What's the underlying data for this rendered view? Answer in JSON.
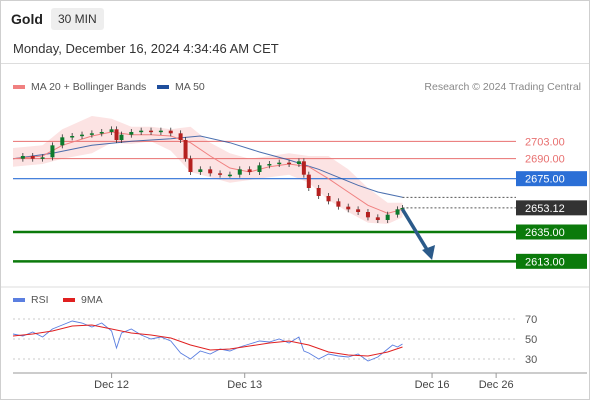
{
  "header": {
    "ticker": "Gold",
    "timeframe": "30 MIN",
    "datetime": "Monday, December 16, 2024 4:34:46 AM CET"
  },
  "legend": {
    "ma20": {
      "label": "MA 20 + Bollinger Bands",
      "color": "#f08080"
    },
    "ma50": {
      "label": "MA 50",
      "color": "#1f4e9c"
    },
    "copyright": "Research © 2024 Trading Central"
  },
  "rsi_legend": {
    "rsi": {
      "label": "RSI",
      "color": "#5b7fe0"
    },
    "ma9": {
      "label": "9MA",
      "color": "#e02020"
    }
  },
  "chart_data": [
    {
      "type": "line",
      "panel": "price",
      "ylim": [
        2602,
        2722
      ],
      "xlim": [
        0,
        100
      ],
      "x_ticks": [
        {
          "label": "Dec 12",
          "x": 20
        },
        {
          "label": "Dec 13",
          "x": 47
        },
        {
          "label": "Dec 16",
          "x": 85
        },
        {
          "label": "Dec 26",
          "x": 98
        }
      ],
      "levels": [
        {
          "label": "2703.00",
          "value": 2703.0,
          "color": "#e87070",
          "width": 1,
          "tag": "plain"
        },
        {
          "label": "2690.00",
          "value": 2690.0,
          "color": "#e87070",
          "width": 1,
          "tag": "plain"
        },
        {
          "label": "2675.00",
          "value": 2675.0,
          "color": "#2b6fd6",
          "width": 1.2,
          "tag": "box"
        },
        {
          "label": "2635.00",
          "value": 2635.0,
          "color": "#0b7a0b",
          "width": 2.5,
          "tag": "box"
        },
        {
          "label": "2613.00",
          "value": 2613.0,
          "color": "#0b7a0b",
          "width": 2.5,
          "tag": "box"
        }
      ],
      "last_price": {
        "label": "2653.12",
        "value": 2653.12,
        "color": "#333333"
      },
      "forecast_arrow": {
        "from": [
          79,
          2652
        ],
        "to": [
          85,
          2614
        ],
        "color": "#2b5a8a"
      },
      "ma20": [
        [
          0,
          2690
        ],
        [
          6,
          2692
        ],
        [
          10,
          2700
        ],
        [
          16,
          2707
        ],
        [
          20,
          2710
        ],
        [
          24,
          2708
        ],
        [
          28,
          2708
        ],
        [
          32,
          2707
        ],
        [
          36,
          2702
        ],
        [
          40,
          2692
        ],
        [
          44,
          2683
        ],
        [
          48,
          2680
        ],
        [
          52,
          2684
        ],
        [
          56,
          2686
        ],
        [
          60,
          2684
        ],
        [
          64,
          2675
        ],
        [
          68,
          2665
        ],
        [
          72,
          2655
        ],
        [
          76,
          2649
        ],
        [
          79,
          2652
        ]
      ],
      "ma50": [
        [
          0,
          2690
        ],
        [
          8,
          2694
        ],
        [
          16,
          2700
        ],
        [
          24,
          2703
        ],
        [
          32,
          2705
        ],
        [
          38,
          2707
        ],
        [
          44,
          2702
        ],
        [
          50,
          2695
        ],
        [
          56,
          2689
        ],
        [
          62,
          2682
        ],
        [
          66,
          2676
        ],
        [
          70,
          2670
        ],
        [
          74,
          2665
        ],
        [
          79,
          2661
        ]
      ],
      "bb_upper": [
        [
          0,
          2698
        ],
        [
          6,
          2700
        ],
        [
          10,
          2712
        ],
        [
          16,
          2722
        ],
        [
          20,
          2720
        ],
        [
          24,
          2714
        ],
        [
          28,
          2714
        ],
        [
          32,
          2712
        ],
        [
          36,
          2714
        ],
        [
          40,
          2702
        ],
        [
          44,
          2694
        ],
        [
          48,
          2690
        ],
        [
          52,
          2692
        ],
        [
          56,
          2694
        ],
        [
          60,
          2692
        ],
        [
          64,
          2692
        ],
        [
          68,
          2682
        ],
        [
          72,
          2668
        ],
        [
          76,
          2657
        ],
        [
          79,
          2657
        ]
      ],
      "bb_lower": [
        [
          0,
          2684
        ],
        [
          6,
          2686
        ],
        [
          10,
          2690
        ],
        [
          16,
          2694
        ],
        [
          20,
          2702
        ],
        [
          24,
          2701
        ],
        [
          28,
          2703
        ],
        [
          32,
          2696
        ],
        [
          36,
          2680
        ],
        [
          40,
          2676
        ],
        [
          44,
          2672
        ],
        [
          48,
          2674
        ],
        [
          52,
          2676
        ],
        [
          56,
          2678
        ],
        [
          60,
          2672
        ],
        [
          64,
          2659
        ],
        [
          68,
          2650
        ],
        [
          72,
          2642
        ],
        [
          76,
          2641
        ],
        [
          79,
          2646
        ]
      ],
      "price": [
        [
          0,
          2690
        ],
        [
          2,
          2692
        ],
        [
          4,
          2690
        ],
        [
          6,
          2691
        ],
        [
          8,
          2700
        ],
        [
          10,
          2706
        ],
        [
          12,
          2707
        ],
        [
          14,
          2708
        ],
        [
          16,
          2709
        ],
        [
          18,
          2710
        ],
        [
          20,
          2712
        ],
        [
          21,
          2704
        ],
        [
          22,
          2708
        ],
        [
          24,
          2710
        ],
        [
          26,
          2711
        ],
        [
          28,
          2710
        ],
        [
          30,
          2711
        ],
        [
          32,
          2709
        ],
        [
          34,
          2704
        ],
        [
          35,
          2690
        ],
        [
          36,
          2680
        ],
        [
          38,
          2682
        ],
        [
          40,
          2679
        ],
        [
          42,
          2678
        ],
        [
          44,
          2678
        ],
        [
          46,
          2682
        ],
        [
          48,
          2680
        ],
        [
          50,
          2685
        ],
        [
          52,
          2686
        ],
        [
          54,
          2687
        ],
        [
          56,
          2686
        ],
        [
          58,
          2688
        ],
        [
          59,
          2678
        ],
        [
          60,
          2668
        ],
        [
          62,
          2662
        ],
        [
          64,
          2658
        ],
        [
          66,
          2654
        ],
        [
          68,
          2652
        ],
        [
          70,
          2650
        ],
        [
          72,
          2646
        ],
        [
          74,
          2644
        ],
        [
          76,
          2648
        ],
        [
          78,
          2652
        ],
        [
          79,
          2653
        ]
      ]
    },
    {
      "type": "line",
      "panel": "rsi",
      "ylim": [
        20,
        80
      ],
      "y_ticks": [
        30,
        50,
        70
      ],
      "rsi": [
        [
          0,
          55
        ],
        [
          2,
          53
        ],
        [
          4,
          57
        ],
        [
          6,
          52
        ],
        [
          8,
          60
        ],
        [
          10,
          64
        ],
        [
          12,
          68
        ],
        [
          14,
          66
        ],
        [
          16,
          62
        ],
        [
          18,
          66
        ],
        [
          20,
          58
        ],
        [
          21,
          41
        ],
        [
          22,
          56
        ],
        [
          24,
          60
        ],
        [
          26,
          54
        ],
        [
          28,
          50
        ],
        [
          30,
          52
        ],
        [
          32,
          48
        ],
        [
          34,
          36
        ],
        [
          36,
          30
        ],
        [
          38,
          38
        ],
        [
          40,
          35
        ],
        [
          42,
          40
        ],
        [
          44,
          38
        ],
        [
          46,
          42
        ],
        [
          48,
          45
        ],
        [
          50,
          48
        ],
        [
          52,
          47
        ],
        [
          54,
          50
        ],
        [
          56,
          46
        ],
        [
          58,
          52
        ],
        [
          59,
          38
        ],
        [
          60,
          36
        ],
        [
          62,
          30
        ],
        [
          64,
          35
        ],
        [
          66,
          33
        ],
        [
          68,
          32
        ],
        [
          70,
          35
        ],
        [
          72,
          28
        ],
        [
          74,
          32
        ],
        [
          76,
          40
        ],
        [
          77,
          44
        ],
        [
          78,
          42
        ],
        [
          79,
          45
        ]
      ],
      "ma9": [
        [
          0,
          53
        ],
        [
          4,
          55
        ],
        [
          8,
          58
        ],
        [
          12,
          63
        ],
        [
          16,
          64
        ],
        [
          20,
          60
        ],
        [
          24,
          56
        ],
        [
          28,
          54
        ],
        [
          32,
          51
        ],
        [
          36,
          44
        ],
        [
          40,
          39
        ],
        [
          44,
          40
        ],
        [
          48,
          43
        ],
        [
          52,
          46
        ],
        [
          56,
          48
        ],
        [
          60,
          44
        ],
        [
          64,
          37
        ],
        [
          68,
          34
        ],
        [
          72,
          33
        ],
        [
          76,
          37
        ],
        [
          79,
          42
        ]
      ]
    }
  ]
}
